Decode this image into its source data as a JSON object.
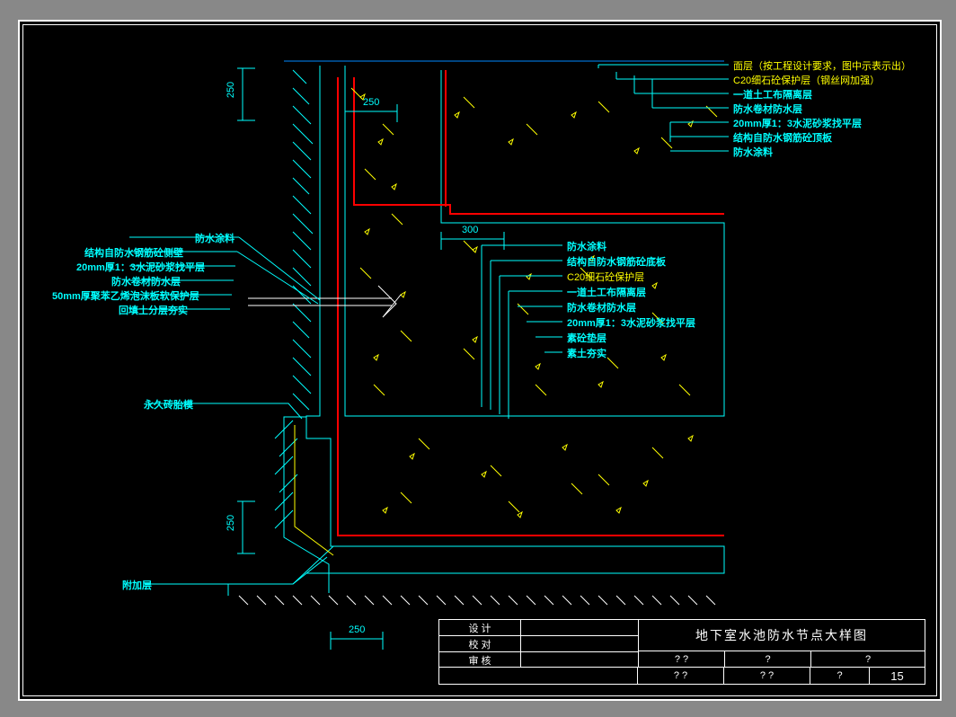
{
  "dimensions": {
    "d250_left_top": "250",
    "d250_inner": "250",
    "d300_inner": "300",
    "d250_left_bottom": "250",
    "d250_bottom": "250"
  },
  "labels_top_right": [
    "面层（按工程设计要求，图中示表示出）",
    "C20细石砼保护层（钢丝网加强）",
    "一道土工布隔离层",
    "防水卷材防水层",
    "20mm厚1：3水泥砂浆找平层",
    "结构自防水钢筋砼顶板",
    "防水涂料"
  ],
  "labels_mid_right": [
    "防水涂料",
    "结构自防水钢筋砼底板",
    "C20细石砼保护层",
    "一道土工布隔离层",
    "防水卷材防水层",
    "20mm厚1：3水泥砂浆找平层",
    "素砼垫层",
    "素土夯实"
  ],
  "labels_left": [
    "防水涂料",
    "结构自防水钢筋砼侧壁",
    "20mm厚1：3水泥砂浆找平层",
    "防水卷材防水层",
    "50mm厚聚苯乙烯泡沫板软保护层",
    "回填土分层夯实"
  ],
  "label_brick": "永久砖胎模",
  "label_additional": "附加层",
  "title_block": {
    "design": "设 计",
    "proofread": "校 对",
    "review": "审 核",
    "title": "地下室水池防水节点大样图",
    "q": "?",
    "qq": "? ?",
    "num": "15"
  }
}
